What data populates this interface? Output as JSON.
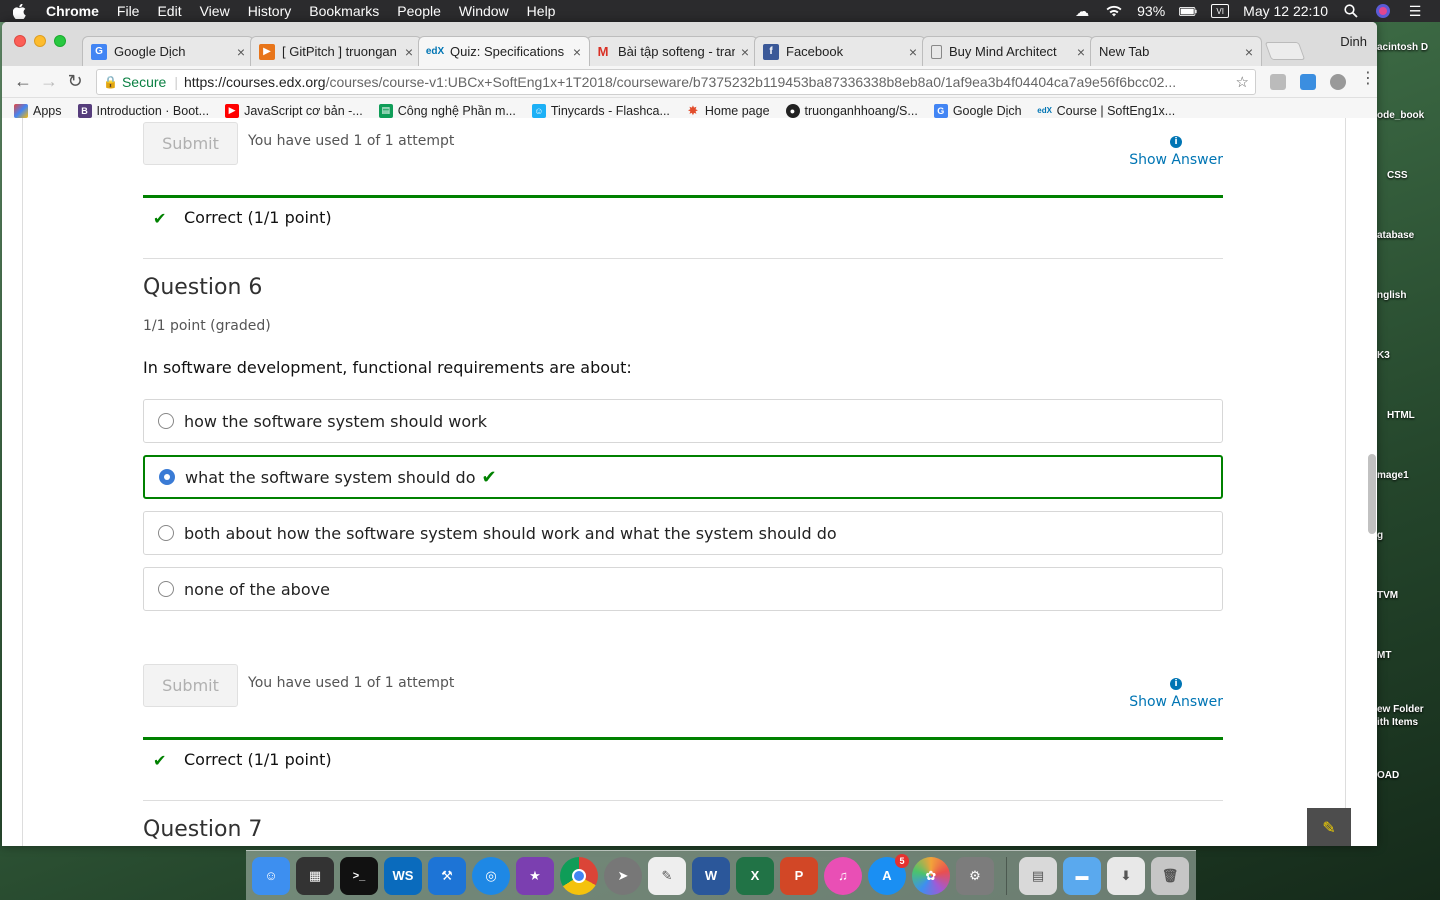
{
  "menubar": {
    "app_name": "Chrome",
    "items": [
      "File",
      "Edit",
      "View",
      "History",
      "Bookmarks",
      "People",
      "Window",
      "Help"
    ],
    "battery": "93%",
    "clock": "May 12  22:10"
  },
  "browser": {
    "profile_name": "Dinh",
    "tabs": [
      {
        "label": "Google Dịch",
        "favicon": "google-translate-icon",
        "color": "#4285f4"
      },
      {
        "label": "[ GitPitch ] truongan",
        "favicon": "gitpitch-icon",
        "color": "#e8751a"
      },
      {
        "label": "Quiz: Specifications",
        "favicon": "edx-icon",
        "color": "#0075b4"
      },
      {
        "label": "Bài tập softeng - tran",
        "favicon": "gmail-icon",
        "color": "#d93025"
      },
      {
        "label": "Facebook",
        "favicon": "facebook-icon",
        "color": "#3b5998"
      },
      {
        "label": "Buy Mind Architect",
        "favicon": "page-icon",
        "color": "#888888"
      },
      {
        "label": "New Tab",
        "favicon": "",
        "color": "#cccccc"
      }
    ],
    "address": {
      "secure_label": "Secure",
      "url_host": "https://courses.edx.org",
      "url_path": "/courses/course-v1:UBCx+SoftEng1x+1T2018/courseware/b7375232b119453ba87336338b8eb8a0/1af9ea3b4f04404ca7a9e56f6bcc02..."
    },
    "bookmarks": [
      {
        "label": "Apps",
        "icon": "apps-grid-icon",
        "color": "#e8453c"
      },
      {
        "label": "Introduction · Boot...",
        "icon": "bootstrap-icon",
        "color": "#563d7c"
      },
      {
        "label": "JavaScript cơ bản -...",
        "icon": "youtube-icon",
        "color": "#ff0000"
      },
      {
        "label": "Công nghệ Phần m...",
        "icon": "sheets-icon",
        "color": "#0f9d58"
      },
      {
        "label": "Tinycards - Flashca...",
        "icon": "tinycards-icon",
        "color": "#1cb0f6"
      },
      {
        "label": "Home page",
        "icon": "home-star-icon",
        "color": "#e24d2c"
      },
      {
        "label": "truonganhhoang/S...",
        "icon": "github-icon",
        "color": "#222222"
      },
      {
        "label": "Google Dịch",
        "icon": "google-translate-icon",
        "color": "#4285f4"
      },
      {
        "label": "Course | SoftEng1x...",
        "icon": "edx-icon",
        "color": "#0075b4"
      }
    ]
  },
  "quiz": {
    "prev_block": {
      "submit_label": "Submit",
      "attempts_text": "You have used 1 of 1 attempt",
      "show_answer_label": "Show Answer",
      "result_text": "Correct (1/1 point)"
    },
    "question": {
      "title": "Question 6",
      "points": "1/1 point (graded)",
      "prompt": "In software development, functional requirements are about:",
      "options": [
        {
          "label": "how the software system should work",
          "selected": false
        },
        {
          "label": "what the software system should do",
          "selected": true,
          "correct": true
        },
        {
          "label": "both about how the software system should work and what the system should do",
          "selected": false
        },
        {
          "label": "none of the above",
          "selected": false
        }
      ],
      "submit_label": "Submit",
      "attempts_text": "You have used 1 of 1 attempt",
      "show_answer_label": "Show Answer",
      "result_text": "Correct (1/1 point)"
    },
    "next_question_title": "Question 7"
  },
  "desktop_labels": [
    "acintosh\nD",
    "ode_book",
    "CSS",
    "atabase",
    "nglish",
    "K3",
    "HTML",
    "mage1",
    "g",
    "TVM",
    "MT",
    "ew Folder\nith Items",
    "OAD"
  ],
  "dock": {
    "apps": [
      {
        "name": "finder-icon",
        "color": "#3d8ff0",
        "glyph": "☺"
      },
      {
        "name": "activity-monitor-icon",
        "color": "#333333",
        "glyph": "▦"
      },
      {
        "name": "terminal-icon",
        "color": "#111111",
        "glyph": ">_"
      },
      {
        "name": "webstorm-icon",
        "color": "#0a6bbd",
        "glyph": "WS"
      },
      {
        "name": "xcode-icon",
        "color": "#1d74d6",
        "glyph": "⚒"
      },
      {
        "name": "safari-icon",
        "color": "#1e88e5",
        "glyph": "◎"
      },
      {
        "name": "starred-icon",
        "color": "#7b3fb0",
        "glyph": "★"
      },
      {
        "name": "chrome-icon",
        "color": "#db4437",
        "glyph": "◉"
      },
      {
        "name": "launchpad-icon",
        "color": "#777777",
        "glyph": "🚀"
      },
      {
        "name": "textedit-icon",
        "color": "#eeeeee",
        "glyph": "✎"
      },
      {
        "name": "word-icon",
        "color": "#2b579a",
        "glyph": "W"
      },
      {
        "name": "excel-icon",
        "color": "#217346",
        "glyph": "X"
      },
      {
        "name": "powerpoint-icon",
        "color": "#d24726",
        "glyph": "P"
      },
      {
        "name": "itunes-icon",
        "color": "#e94fb5",
        "glyph": "♫"
      },
      {
        "name": "app-store-icon",
        "color": "#1a8ff3",
        "glyph": "A",
        "badge": "5"
      },
      {
        "name": "photos-icon",
        "color": "#f2a33a",
        "glyph": "✿"
      },
      {
        "name": "system-preferences-icon",
        "color": "#7c7c7c",
        "glyph": "⚙"
      }
    ],
    "apps_right": [
      {
        "name": "files-icon",
        "color": "#d9d9d9",
        "glyph": "▤"
      },
      {
        "name": "folder-icon",
        "color": "#5aa9ee",
        "glyph": "▬"
      },
      {
        "name": "downloads-icon",
        "color": "#e8e8e8",
        "glyph": "⬇"
      },
      {
        "name": "trash-icon",
        "color": "#c6c6c6",
        "glyph": "🗑"
      }
    ]
  }
}
